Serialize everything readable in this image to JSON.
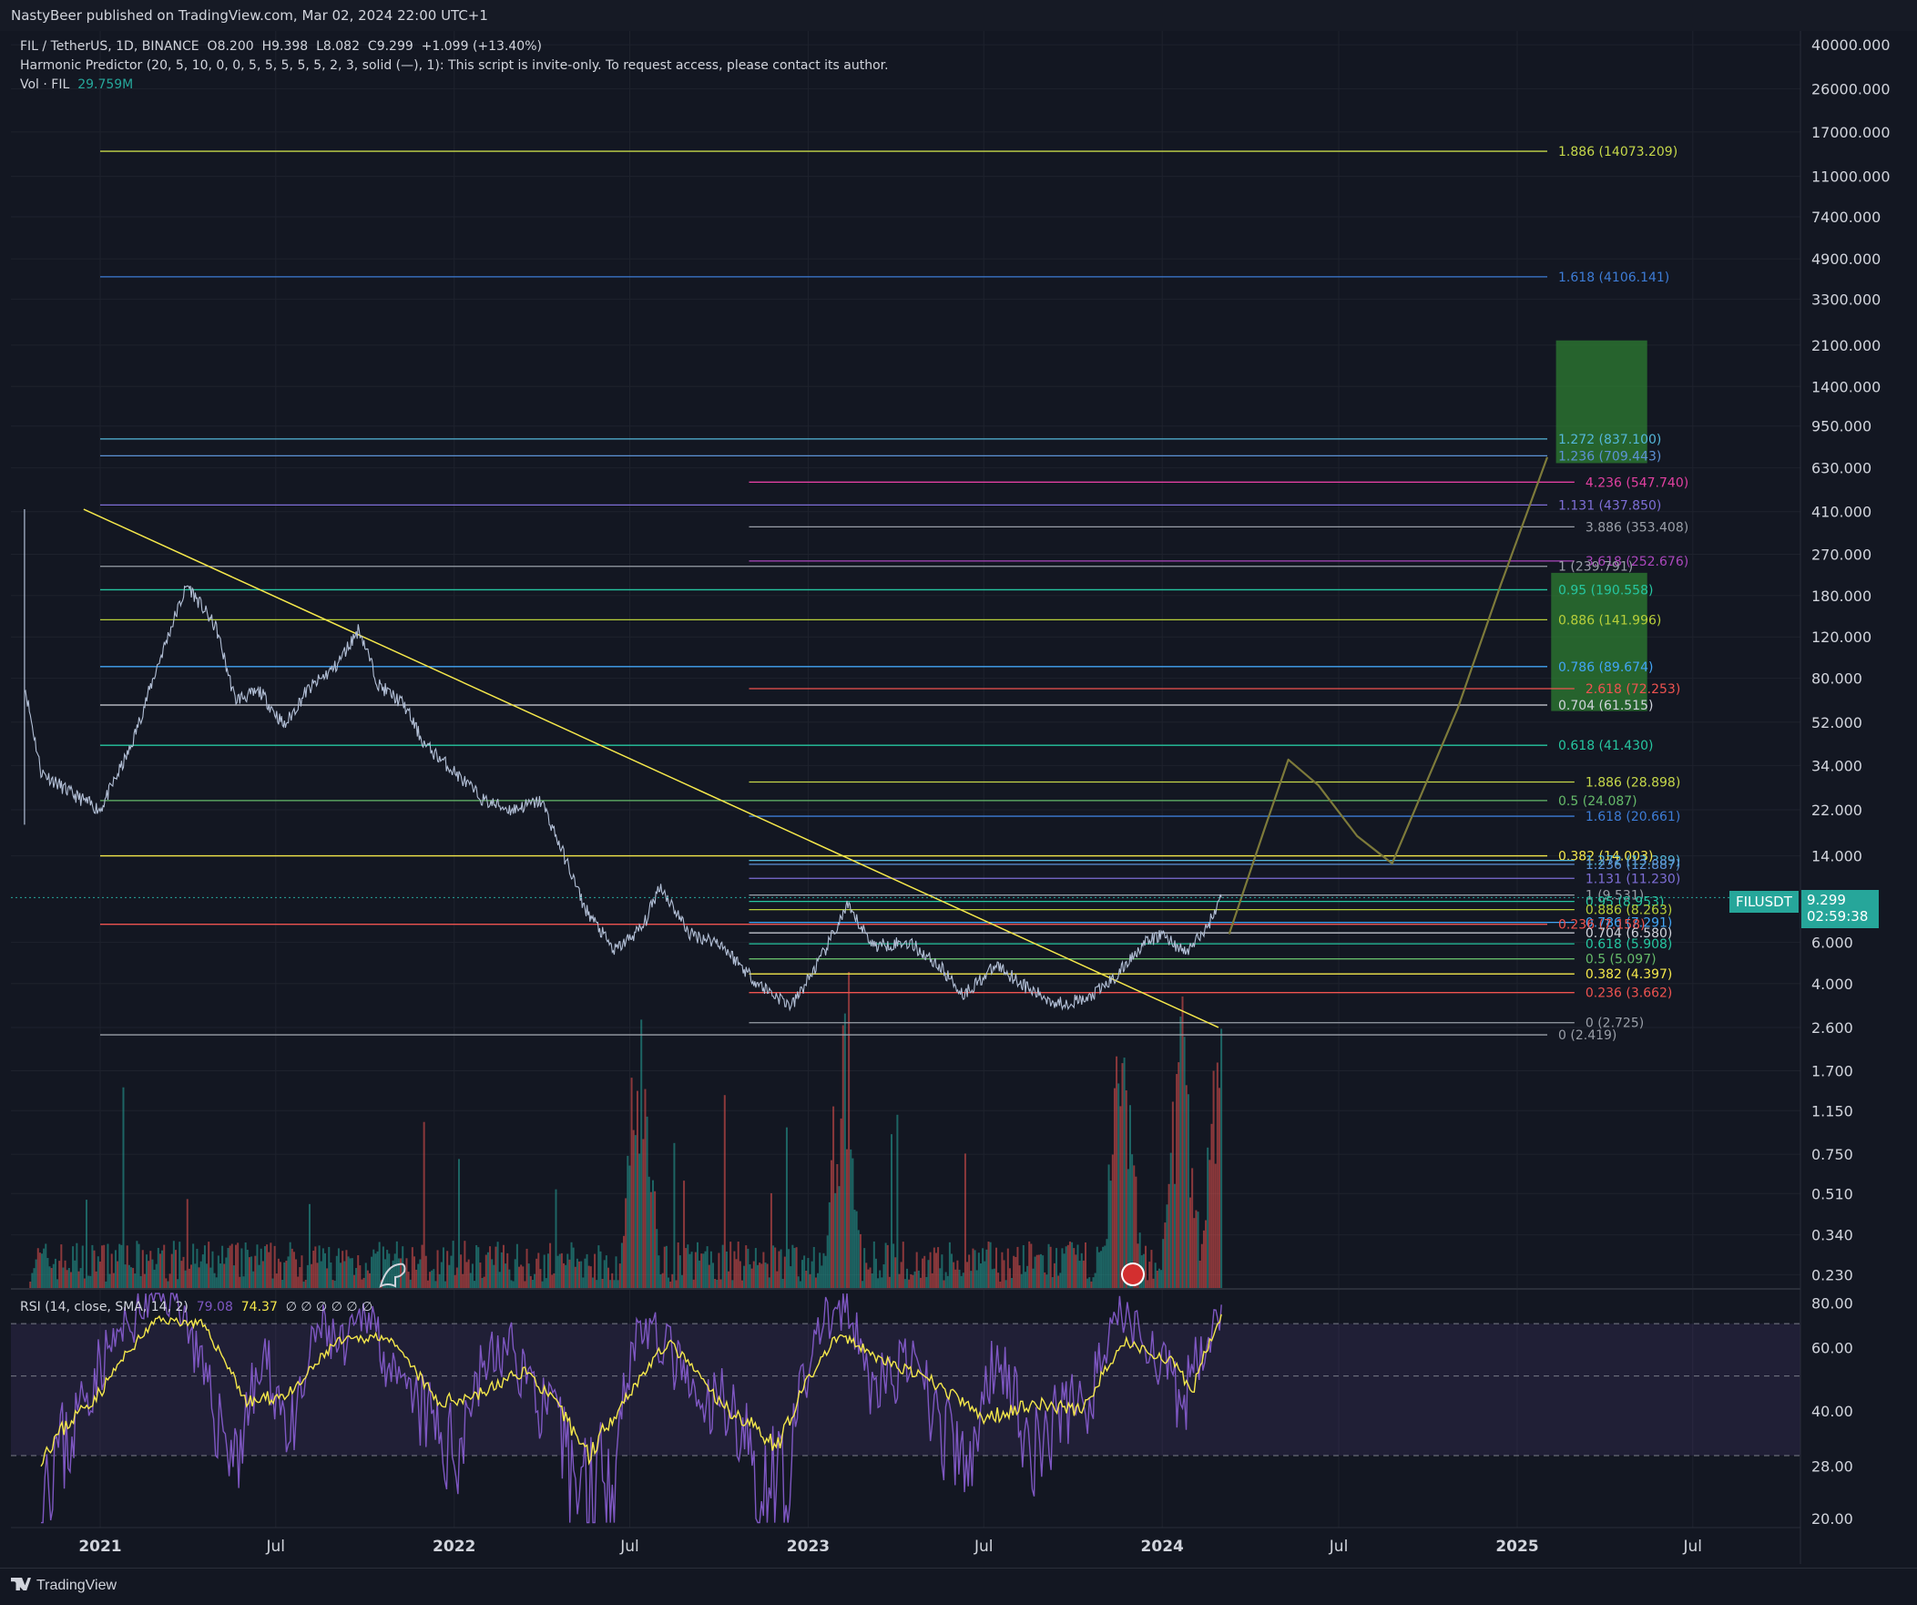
{
  "topbar": {
    "text": "NastyBeer published on TradingView.com, Mar 02, 2024 22:00 UTC+1"
  },
  "legend": {
    "symbol": "FIL / TetherUS, 1D, BINANCE",
    "o_label": "O",
    "o": "8.200",
    "h_label": "H",
    "h": "9.398",
    "l_label": "L",
    "l": "8.082",
    "c_label": "C",
    "c": "9.299",
    "change": "+1.099 (+13.40%)",
    "indicator": "Harmonic Predictor (20, 5, 10, 0, 0, 5, 5, 5, 5, 5, 2, 3, solid (—), 1): This script is invite-only. To request access, please contact its author.",
    "vol_label": "Vol · FIL",
    "vol": "29.759M",
    "rsi_label": "RSI (14, close, SMA, 14, 2)",
    "rsi_value": "79.08",
    "rsi_sma": "74.37",
    "rsi_nulls": "∅ ∅ ∅ ∅ ∅ ∅"
  },
  "price_tag": {
    "symbol": "FILUSDT",
    "price": "9.299",
    "countdown": "02:59:38"
  },
  "footer": {
    "brand": "TradingView"
  },
  "colors": {
    "bg": "#131722",
    "up": "#26a69a",
    "down": "#ef5350",
    "price_line": "#b2bfd6",
    "rsi": "#7e57c2",
    "rsi_sma": "#f5e84b",
    "trendline": "#f5e84b",
    "projection": "#7d7a3a"
  },
  "chart_data": [
    {
      "type": "line",
      "title": "FIL / TetherUS, 1D, BINANCE",
      "yscale": "log",
      "ylim": [
        0.2,
        45000
      ],
      "xlim": [
        "2020-10-01",
        "2025-10-20"
      ],
      "x_ticks": [
        "2021",
        "Jul",
        "2022",
        "Jul",
        "2023",
        "Jul",
        "2024",
        "Jul",
        "2025",
        "Jul"
      ],
      "y_ticks": [
        "40000.000",
        "26000.000",
        "17000.000",
        "11000.000",
        "7400.000",
        "4900.000",
        "3300.000",
        "2100.000",
        "1400.000",
        "950.000",
        "630.000",
        "410.000",
        "270.000",
        "180.000",
        "120.000",
        "80.000",
        "52.000",
        "34.000",
        "22.000",
        "14.000",
        "6.000",
        "4.000",
        "2.600",
        "1.700",
        "1.150",
        "0.750",
        "0.510",
        "0.340",
        "0.230"
      ],
      "series": [
        {
          "x": [
            "2020-10-15",
            "2020-11-01",
            "2020-12-01",
            "2021-01-01",
            "2021-02-01",
            "2021-03-01",
            "2021-03-20",
            "2021-04-01",
            "2021-05-01",
            "2021-05-20",
            "2021-06-15",
            "2021-07-10",
            "2021-08-01",
            "2021-09-01",
            "2021-09-25",
            "2021-10-15",
            "2021-11-10",
            "2021-12-01",
            "2022-01-01",
            "2022-02-01",
            "2022-03-01",
            "2022-04-01",
            "2022-05-01",
            "2022-05-15",
            "2022-06-15",
            "2022-07-15",
            "2022-08-01",
            "2022-09-01",
            "2022-10-01",
            "2022-11-10",
            "2022-12-15",
            "2023-01-15",
            "2023-02-10",
            "2023-03-10",
            "2023-04-15",
            "2023-05-15",
            "2023-06-10",
            "2023-07-15",
            "2023-08-20",
            "2023-09-15",
            "2023-10-15",
            "2023-11-15",
            "2023-12-10",
            "2024-01-01",
            "2024-01-25",
            "2024-02-15",
            "2024-03-02"
          ],
          "y": [
            75,
            32,
            26,
            22,
            40,
            90,
            150,
            200,
            130,
            65,
            70,
            50,
            70,
            90,
            130,
            75,
            62,
            42,
            32,
            24,
            22,
            24,
            12,
            8.5,
            5.5,
            7.0,
            10.5,
            6.5,
            6.0,
            4.0,
            3.2,
            5.2,
            8.5,
            5.8,
            6.0,
            4.8,
            3.6,
            4.8,
            3.7,
            3.3,
            3.4,
            4.3,
            5.8,
            6.5,
            5.4,
            6.8,
            9.299
          ]
        }
      ],
      "volume_peak_dates": [
        "2022-07-10",
        "2023-02-05",
        "2023-11-20",
        "2024-01-20",
        "2024-02-28"
      ],
      "trendline": {
        "from": {
          "x": "2020-12-15",
          "y": 420
        },
        "to": {
          "x": "2024-02-28",
          "y": 2.6
        }
      },
      "projection": [
        {
          "x": "2024-03-10",
          "y": 6.5
        },
        {
          "x": "2024-04-15",
          "y": 18
        },
        {
          "x": "2024-05-10",
          "y": 36
        },
        {
          "x": "2024-06-10",
          "y": 28
        },
        {
          "x": "2024-07-20",
          "y": 17
        },
        {
          "x": "2024-08-25",
          "y": 13
        },
        {
          "x": "2024-11-01",
          "y": 60
        },
        {
          "x": "2024-12-15",
          "y": 200
        },
        {
          "x": "2025-02-01",
          "y": 700
        }
      ],
      "target_zones": [
        {
          "x1": "2025-02-10",
          "x2": "2025-05-15",
          "y1": 660,
          "y2": 2200,
          "color": "#2e7d32"
        },
        {
          "x1": "2025-02-05",
          "x2": "2025-05-15",
          "y1": 58,
          "y2": 225,
          "color": "#2e7d32"
        }
      ],
      "fib_levels": [
        {
          "label": "1.886 (14073.209)",
          "ratio": "1.886",
          "value": 14073.209,
          "x1": "2021-01-01",
          "x2": "2025-02-01",
          "color": "#c6d84a"
        },
        {
          "label": "1.618 (4106.141)",
          "ratio": "1.618",
          "value": 4106.141,
          "x1": "2021-01-01",
          "x2": "2025-02-01",
          "color": "#3d7cd6"
        },
        {
          "label": "1.272 (837.100)",
          "ratio": "1.272",
          "value": 837.1,
          "x1": "2021-01-01",
          "x2": "2025-02-01",
          "color": "#54b7d9"
        },
        {
          "label": "1.236 (709.443)",
          "ratio": "1.236",
          "value": 709.443,
          "x1": "2021-01-01",
          "x2": "2025-02-01",
          "color": "#5d92d6"
        },
        {
          "label": "4.236 (547.740)",
          "ratio": "4.236",
          "value": 547.74,
          "x1": "2022-11-01",
          "x2": "2025-03-01",
          "color": "#e040a0"
        },
        {
          "label": "1.131 (437.850)",
          "ratio": "1.131",
          "value": 437.85,
          "x1": "2021-01-01",
          "x2": "2025-02-01",
          "color": "#7e6ed6"
        },
        {
          "label": "3.886 (353.408)",
          "ratio": "3.886",
          "value": 353.408,
          "x1": "2022-11-01",
          "x2": "2025-03-01",
          "color": "#9a9fa8"
        },
        {
          "label": "3.618 (252.676)",
          "ratio": "3.618",
          "value": 252.676,
          "x1": "2022-11-01",
          "x2": "2025-03-01",
          "color": "#ab47bc"
        },
        {
          "label": "1 (239.791)",
          "ratio": "1",
          "value": 239.791,
          "x1": "2021-01-01",
          "x2": "2025-02-01",
          "color": "#9a9fa8"
        },
        {
          "label": "0.95 (190.558)",
          "ratio": "0.95",
          "value": 190.558,
          "x1": "2021-01-01",
          "x2": "2025-02-01",
          "color": "#26c6a0"
        },
        {
          "label": "0.886 (141.996)",
          "ratio": "0.886",
          "value": 141.996,
          "x1": "2021-01-01",
          "x2": "2025-02-01",
          "color": "#b8cf3a"
        },
        {
          "label": "0.786 (89.674)",
          "ratio": "0.786",
          "value": 89.674,
          "x1": "2021-01-01",
          "x2": "2025-02-01",
          "color": "#42a5f5"
        },
        {
          "label": "2.618 (72.253)",
          "ratio": "2.618",
          "value": 72.253,
          "x1": "2022-11-01",
          "x2": "2025-03-01",
          "color": "#ef5350"
        },
        {
          "label": "0.704 (61.515)",
          "ratio": "0.704",
          "value": 61.515,
          "x1": "2021-01-01",
          "x2": "2025-02-01",
          "color": "#d1d4dc"
        },
        {
          "label": "0.618 (41.430)",
          "ratio": "0.618",
          "value": 41.43,
          "x1": "2021-01-01",
          "x2": "2025-02-01",
          "color": "#26c6a0"
        },
        {
          "label": "1.886 (28.898)",
          "ratio": "1.886",
          "value": 28.898,
          "x1": "2022-11-01",
          "x2": "2025-03-01",
          "color": "#c6d84a"
        },
        {
          "label": "0.5 (24.087)",
          "ratio": "0.5",
          "value": 24.087,
          "x1": "2021-01-01",
          "x2": "2025-02-01",
          "color": "#66bb6a"
        },
        {
          "label": "1.618 (20.661)",
          "ratio": "1.618",
          "value": 20.661,
          "x1": "2022-11-01",
          "x2": "2025-03-01",
          "color": "#3d7cd6"
        },
        {
          "label": "0.382 (14.003)",
          "ratio": "0.382",
          "value": 14.003,
          "x1": "2021-01-01",
          "x2": "2025-02-01",
          "color": "#f5e84b"
        },
        {
          "label": "1.272 (13.389)",
          "ratio": "1.272",
          "value": 13.389,
          "x1": "2022-11-01",
          "x2": "2025-03-01",
          "color": "#54b7d9"
        },
        {
          "label": "1.236 (12.887)",
          "ratio": "1.236",
          "value": 12.887,
          "x1": "2022-11-01",
          "x2": "2025-03-01",
          "color": "#5d92d6"
        },
        {
          "label": "1.131 (11.230)",
          "ratio": "1.131",
          "value": 11.23,
          "x1": "2022-11-01",
          "x2": "2025-03-01",
          "color": "#7e6ed6"
        },
        {
          "label": "1 (9.531)",
          "ratio": "1",
          "value": 9.531,
          "x1": "2022-11-01",
          "x2": "2025-03-01",
          "color": "#9a9fa8"
        },
        {
          "label": "0.95 (8.953)",
          "ratio": "0.95",
          "value": 8.953,
          "x1": "2022-11-01",
          "x2": "2025-03-01",
          "color": "#26c6a0"
        },
        {
          "label": "0.886 (8.263)",
          "ratio": "0.886",
          "value": 8.263,
          "x1": "2022-11-01",
          "x2": "2025-03-01",
          "color": "#b8cf3a"
        },
        {
          "label": "0.786 (7.291)",
          "ratio": "0.786",
          "value": 7.291,
          "x1": "2022-11-01",
          "x2": "2025-03-01",
          "color": "#42a5f5"
        },
        {
          "label": "0.236 (7.158)",
          "ratio": "0.236",
          "value": 7.158,
          "x1": "2021-01-01",
          "x2": "2025-02-01",
          "color": "#ef5350"
        },
        {
          "label": "0.704 (6.580)",
          "ratio": "0.704",
          "value": 6.58,
          "x1": "2022-11-01",
          "x2": "2025-03-01",
          "color": "#d1d4dc"
        },
        {
          "label": "0.618 (5.908)",
          "ratio": "0.618",
          "value": 5.908,
          "x1": "2022-11-01",
          "x2": "2025-03-01",
          "color": "#26c6a0"
        },
        {
          "label": "0.5 (5.097)",
          "ratio": "0.5",
          "value": 5.097,
          "x1": "2022-11-01",
          "x2": "2025-03-01",
          "color": "#66bb6a"
        },
        {
          "label": "0.382 (4.397)",
          "ratio": "0.382",
          "value": 4.397,
          "x1": "2022-11-01",
          "x2": "2025-03-01",
          "color": "#f5e84b"
        },
        {
          "label": "0.236 (3.662)",
          "ratio": "0.236",
          "value": 3.662,
          "x1": "2022-11-01",
          "x2": "2025-03-01",
          "color": "#ef5350"
        },
        {
          "label": "0 (2.725)",
          "ratio": "0",
          "value": 2.725,
          "x1": "2022-11-01",
          "x2": "2025-03-01",
          "color": "#9a9fa8"
        },
        {
          "label": "0 (2.419)",
          "ratio": "0",
          "value": 2.419,
          "x1": "2021-01-01",
          "x2": "2025-02-01",
          "color": "#9a9fa8"
        }
      ],
      "current_price": 9.299,
      "grid": true
    },
    {
      "type": "line",
      "title": "RSI (14, close, SMA, 14, 2)",
      "yscale": "log",
      "ylim": [
        19,
        86
      ],
      "y_ticks": [
        "80.00",
        "60.00",
        "40.00",
        "28.00",
        "20.00"
      ],
      "bands": {
        "upper": 70,
        "middle": 50,
        "lower": 30
      },
      "series": [
        {
          "name": "RSI",
          "x": [
            "2020-11-01",
            "2020-12-01",
            "2021-01-01",
            "2021-02-01",
            "2021-03-01",
            "2021-03-25",
            "2021-04-20",
            "2021-05-20",
            "2021-06-20",
            "2021-07-20",
            "2021-08-15",
            "2021-09-10",
            "2021-10-05",
            "2021-11-01",
            "2021-12-01",
            "2022-01-01",
            "2022-02-01",
            "2022-03-01",
            "2022-04-01",
            "2022-05-10",
            "2022-06-15",
            "2022-07-10",
            "2022-08-10",
            "2022-09-10",
            "2022-10-10",
            "2022-11-10",
            "2022-12-15",
            "2023-01-15",
            "2023-02-10",
            "2023-03-10",
            "2023-04-15",
            "2023-05-15",
            "2023-06-15",
            "2023-07-15",
            "2023-08-20",
            "2023-09-20",
            "2023-10-20",
            "2023-11-20",
            "2023-12-20",
            "2024-01-20",
            "2024-02-10",
            "2024-03-02"
          ],
          "y": [
            28,
            34,
            55,
            70,
            85,
            80,
            45,
            30,
            55,
            32,
            70,
            58,
            78,
            45,
            40,
            30,
            55,
            60,
            42,
            25,
            30,
            70,
            60,
            38,
            45,
            24,
            30,
            72,
            75,
            45,
            55,
            38,
            25,
            60,
            30,
            40,
            45,
            75,
            62,
            40,
            60,
            79.08
          ]
        },
        {
          "name": "SMA",
          "x": [
            "2020-11-01",
            "2021-01-01",
            "2021-03-01",
            "2021-04-15",
            "2021-06-01",
            "2021-07-20",
            "2021-09-01",
            "2021-10-20",
            "2021-12-15",
            "2022-02-01",
            "2022-03-15",
            "2022-05-20",
            "2022-07-01",
            "2022-08-10",
            "2022-10-01",
            "2022-12-01",
            "2023-02-01",
            "2023-03-20",
            "2023-05-10",
            "2023-07-01",
            "2023-08-20",
            "2023-10-10",
            "2023-11-25",
            "2024-01-10",
            "2024-02-01",
            "2024-03-02"
          ],
          "y": [
            30,
            45,
            72,
            70,
            42,
            45,
            62,
            65,
            42,
            45,
            52,
            30,
            45,
            62,
            42,
            32,
            65,
            55,
            48,
            38,
            42,
            40,
            62,
            55,
            45,
            74.37
          ]
        }
      ]
    }
  ]
}
